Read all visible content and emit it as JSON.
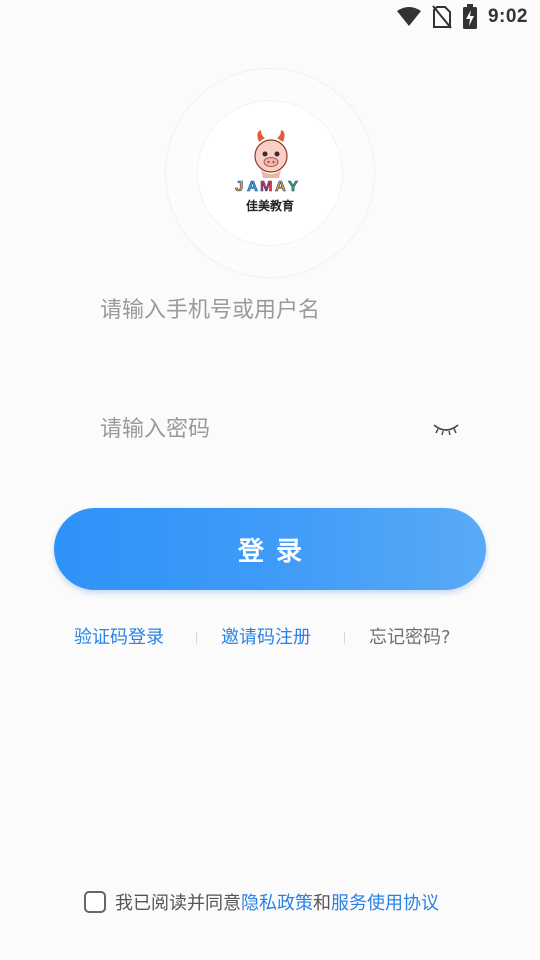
{
  "status_bar": {
    "time": "9:02",
    "icons": [
      "wifi-icon",
      "no-sim-icon",
      "battery-charging-icon"
    ]
  },
  "logo": {
    "brand_text": "JAMAY",
    "caption": "佳美教育"
  },
  "form": {
    "phone_placeholder": "请输入手机号或用户名",
    "password_placeholder": "请输入密码",
    "login_label": "登录"
  },
  "links": {
    "sms_login": "验证码登录",
    "invite_register": "邀请码注册",
    "forgot_password": "忘记密码?"
  },
  "agreement": {
    "prefix": "我已阅读并同意",
    "privacy_policy": "隐私政策",
    "and": "和",
    "service_agreement": "服务使用协议"
  },
  "colors": {
    "accent": "#2a82e4",
    "button_gradient_start": "#2d92f8",
    "button_gradient_end": "#5aaaf6"
  }
}
